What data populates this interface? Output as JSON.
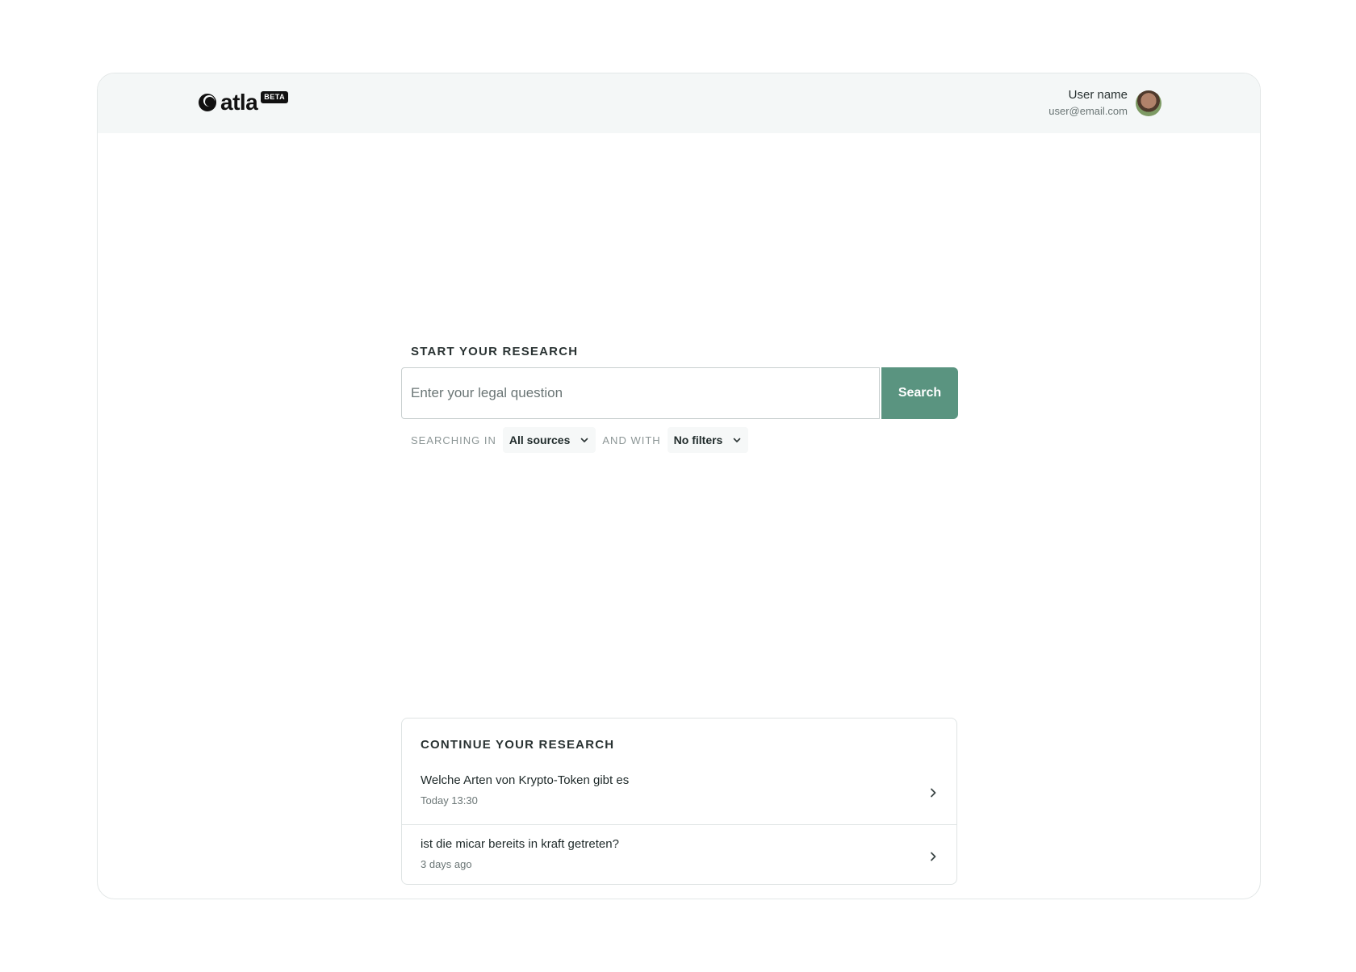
{
  "header": {
    "logo_text": "atla",
    "badge": "BETA",
    "user_name": "User name",
    "user_email": "user@email.com"
  },
  "search": {
    "heading": "START YOUR RESEARCH",
    "placeholder": "Enter your legal question",
    "button_label": "Search",
    "searching_in_label": "SEARCHING IN",
    "sources_value": "All sources",
    "and_with_label": "AND WITH",
    "filters_value": "No filters"
  },
  "continue": {
    "heading": "CONTINUE YOUR RESEARCH",
    "items": [
      {
        "question": "Welche Arten von Krypto-Token gibt es",
        "time": "Today 13:30"
      },
      {
        "question": "ist die micar bereits in kraft getreten?",
        "time": "3 days ago"
      }
    ]
  },
  "colors": {
    "accent": "#5a9480",
    "topbar_bg": "#f4f7f7"
  }
}
